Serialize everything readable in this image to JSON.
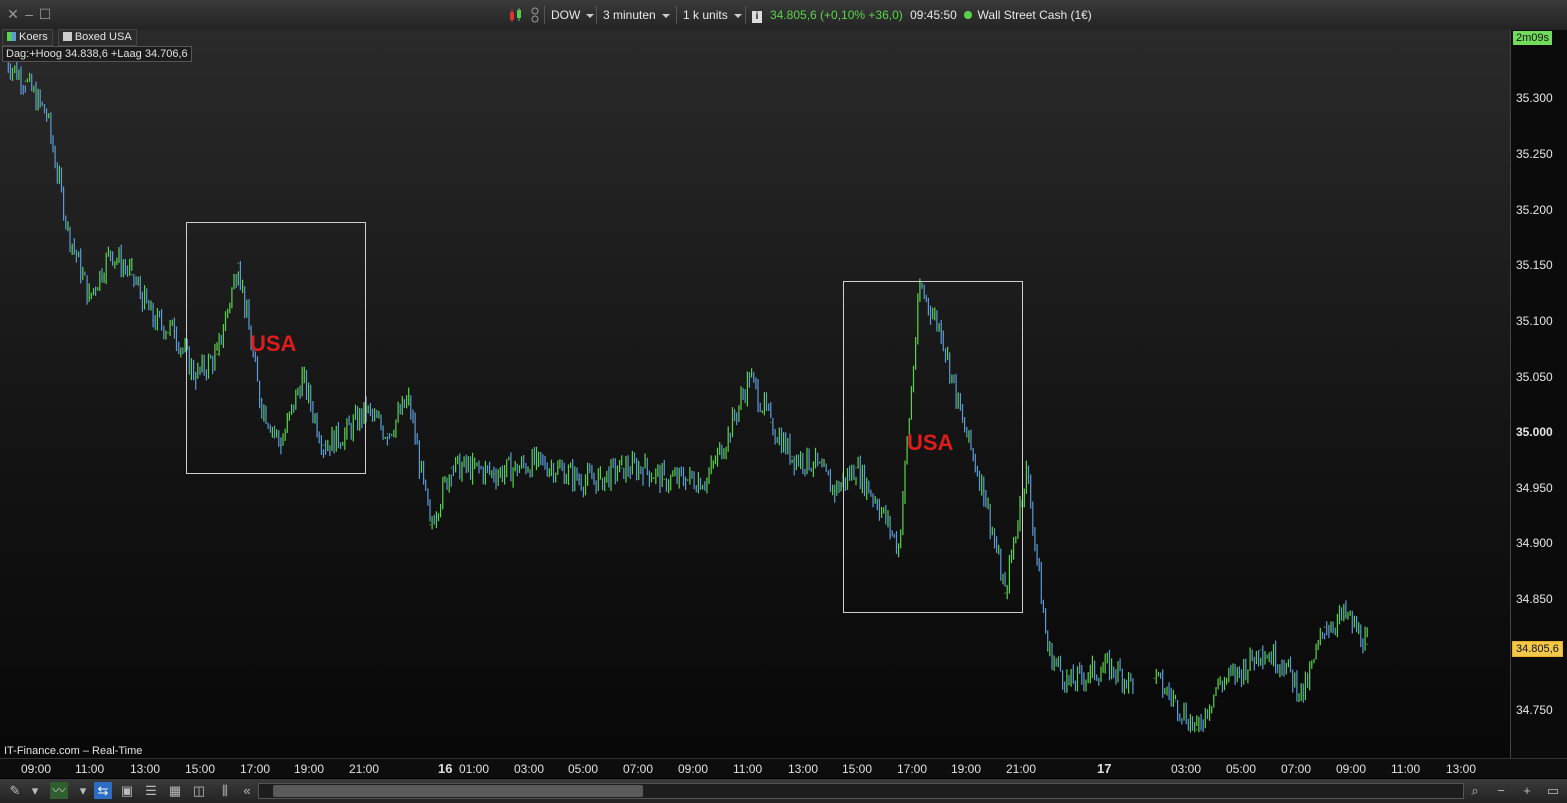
{
  "toolbar": {
    "symbol": "DOW",
    "interval": "3 minuten",
    "units": "1 k units",
    "info_icon": "i",
    "quote": "34.805,6 (+0,10% +36,0)",
    "time": "09:45:50",
    "instrument": "Wall Street Cash (1€)"
  },
  "legend": {
    "series1": "Koers",
    "series2": "Boxed USA"
  },
  "day_info": "Dag:+Hoog 34.838,6 +Laag 34.706,6",
  "timer": "2m09s",
  "last_price": "34.805,6",
  "footer": "IT-Finance.com – Real-Time",
  "colors": {
    "up": "#59d44a",
    "down": "#5b9bd8",
    "box": "#cfcfcf",
    "annotation": "#e01b1b",
    "last": "#f3c74a",
    "timer": "#6fdc5a"
  },
  "chart_data": {
    "type": "line",
    "title": "",
    "xlabel": "",
    "ylabel": "",
    "ylim": [
      34.705,
      35.345
    ],
    "y_ticks": [
      "35.300",
      "35.250",
      "35.200",
      "35.150",
      "35.100",
      "35.050",
      "35.000",
      "34.950",
      "34.900",
      "34.850",
      "34.750"
    ],
    "x_ticks": [
      "09:00",
      "11:00",
      "13:00",
      "15:00",
      "17:00",
      "19:00",
      "21:00",
      "16",
      "01:00",
      "03:00",
      "05:00",
      "07:00",
      "09:00",
      "11:00",
      "13:00",
      "15:00",
      "17:00",
      "19:00",
      "21:00",
      "17",
      "03:00",
      "05:00",
      "07:00",
      "09:00",
      "11:00",
      "13:00"
    ],
    "series": [
      {
        "x": [
          0,
          1,
          2,
          3,
          4,
          5,
          6,
          7,
          8,
          9,
          10,
          11,
          12,
          13,
          14,
          15,
          16,
          17,
          18,
          19,
          20,
          21,
          22,
          23,
          24,
          25,
          26,
          27,
          28,
          29,
          30,
          31,
          32,
          33,
          34,
          35,
          36,
          37,
          38,
          39,
          40,
          41,
          42,
          43,
          44,
          45,
          46,
          47,
          48,
          49,
          50,
          51,
          52,
          53
        ],
        "values": [
          35.32,
          35.3,
          35.27,
          35.17,
          35.11,
          35.15,
          35.13,
          35.09,
          35.08,
          35.04,
          35.06,
          35.14,
          35.02,
          34.98,
          35.04,
          34.98,
          34.99,
          35.01,
          34.99,
          35.02,
          34.91,
          34.96,
          34.96,
          34.955,
          34.96,
          34.965,
          34.96,
          34.95,
          34.95,
          34.96,
          34.96,
          34.95,
          34.95,
          34.95,
          34.99,
          35.04,
          35.0,
          34.97,
          34.965,
          34.94,
          34.96,
          34.93,
          34.89,
          35.12,
          35.08,
          35.0,
          34.94,
          34.85,
          34.96,
          34.8,
          34.77,
          34.78,
          34.785,
          34.77
        ]
      },
      {
        "x": [
          54,
          55,
          56,
          57,
          58,
          59,
          60,
          61,
          62,
          63,
          64
        ],
        "values": [
          34.775,
          34.755,
          34.73,
          34.77,
          34.78,
          34.8,
          34.79,
          34.76,
          34.82,
          34.83,
          34.805
        ]
      }
    ],
    "annotations": [
      {
        "label": "USA"
      },
      {
        "label": "USA"
      }
    ]
  }
}
